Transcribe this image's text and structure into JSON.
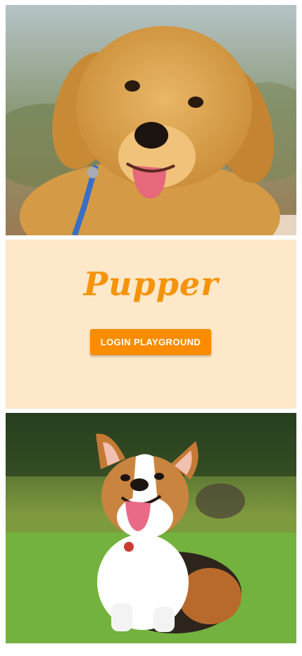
{
  "app": {
    "brand": "Pupper",
    "login_button_label": "LOGIN PLAYGROUND"
  },
  "images": {
    "top": "golden-retriever-puppy-photo",
    "bottom": "corgi-on-grass-photo"
  },
  "colors": {
    "panel_background": "#fde8c9",
    "brand_orange": "#f5930a",
    "button_orange": "#fb8c00",
    "button_text": "#ffffff"
  }
}
